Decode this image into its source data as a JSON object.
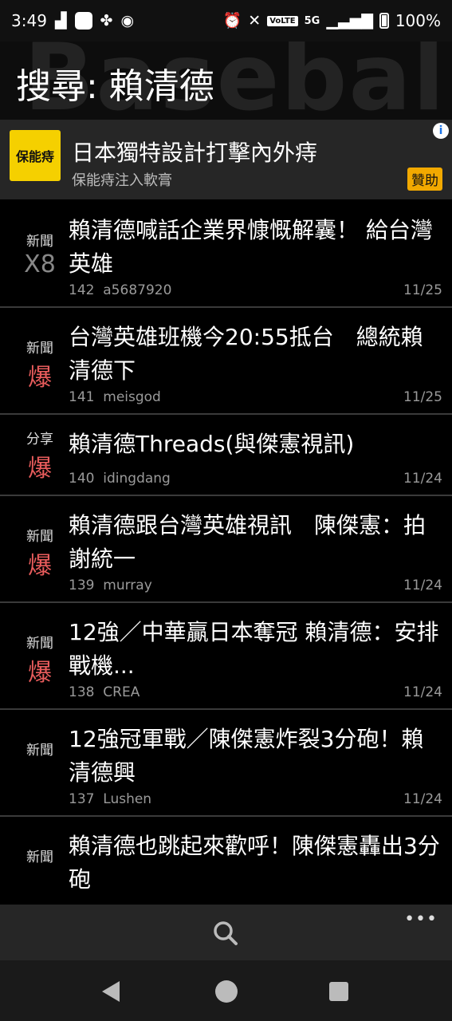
{
  "status_bar": {
    "time": "3:49",
    "battery": "100%",
    "network": "5G",
    "volte": "VoLTE",
    "icons": [
      "signal-icon",
      "app-square-icon",
      "pinwheel-icon",
      "badge-icon",
      "alarm-icon",
      "mute-icon",
      "volte-icon",
      "5g-icon",
      "signal-bars-icon",
      "battery-icon"
    ]
  },
  "header": {
    "watermark": "Baseball",
    "title": "搜尋: 賴清德"
  },
  "ad": {
    "logo_text": "保能痔",
    "title": "日本獨特設計打擊內外痔",
    "subtitle": "保能痔注入軟膏",
    "badge": "贊助",
    "info_icon": "info-icon"
  },
  "posts": [
    {
      "category": "新聞",
      "score": "X8",
      "score_type": "x8",
      "title": "賴清德喊話企業界慷慨解囊！ 給台灣英雄",
      "number": "142",
      "author": "a5687920",
      "date": "11/25"
    },
    {
      "category": "新聞",
      "score": "爆",
      "score_type": "hot",
      "title": "台灣英雄班機今20:55抵台　總統賴清德下",
      "number": "141",
      "author": "meisgod",
      "date": "11/25"
    },
    {
      "category": "分享",
      "score": "爆",
      "score_type": "hot",
      "title": "賴清德Threads(與傑憲視訊)",
      "number": "140",
      "author": "idingdang",
      "date": "11/24"
    },
    {
      "category": "新聞",
      "score": "爆",
      "score_type": "hot",
      "title": "賴清德跟台灣英雄視訊　陳傑憲：拍謝統一",
      "number": "139",
      "author": "murray",
      "date": "11/24"
    },
    {
      "category": "新聞",
      "score": "爆",
      "score_type": "hot",
      "title": "12強／中華贏日本奪冠 賴清德：安排戰機...",
      "number": "138",
      "author": "CREA",
      "date": "11/24"
    },
    {
      "category": "新聞",
      "score": "",
      "score_type": "none",
      "title": "12強冠軍戰／陳傑憲炸裂3分砲！賴清德興",
      "number": "137",
      "author": "Lushen",
      "date": "11/24"
    },
    {
      "category": "新聞",
      "score": "",
      "score_type": "none",
      "title": "賴清德也跳起來歡呼！陳傑憲轟出3分砲",
      "number": "",
      "author": "",
      "date": ""
    }
  ],
  "toolbar": {
    "search_icon": "search-icon",
    "more_label": "•••"
  },
  "nav": {
    "icons": [
      "back-icon",
      "home-icon",
      "recents-icon"
    ]
  }
}
